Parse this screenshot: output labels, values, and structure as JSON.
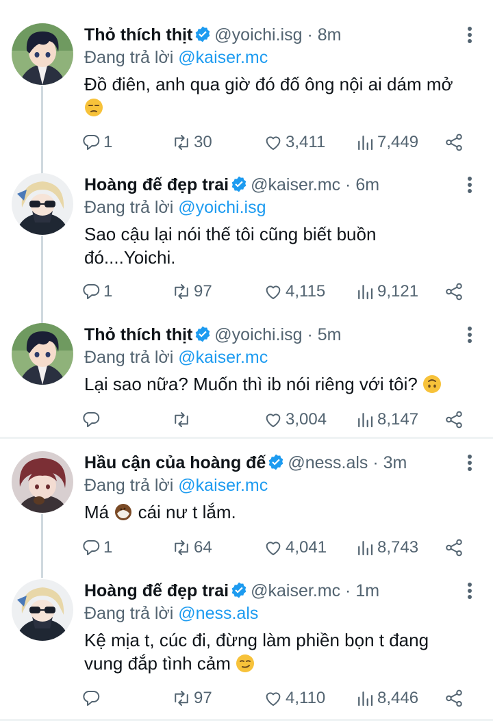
{
  "reply_prefix": "Đang trả lời",
  "tweets": [
    {
      "name": "Thỏ thích thịt",
      "handle": "@yoichi.isg",
      "time": "8m",
      "reply_to": "@kaiser.mc",
      "text_lines": [
        "Đồ điên, anh qua giờ đó đố ông nội ai dám mở"
      ],
      "trailing_emoji": "unamused-face",
      "replies": "1",
      "retweets": "30",
      "likes": "3,411",
      "views": "7,449",
      "avatar": "yoichi"
    },
    {
      "name": "Hoàng đế đẹp trai",
      "handle": "@kaiser.mc",
      "time": "6m",
      "reply_to": "@yoichi.isg",
      "text_lines": [
        "Sao cậu lại nói thế tôi cũng biết buồn",
        "đó....Yoichi."
      ],
      "replies": "1",
      "retweets": "97",
      "likes": "4,115",
      "views": "9,121",
      "avatar": "kaiser"
    },
    {
      "name": "Thỏ thích thịt",
      "handle": "@yoichi.isg",
      "time": "5m",
      "reply_to": "@kaiser.mc",
      "text_lines": [
        "Lại sao nữa? Muốn thì ib nói riêng với tôi?"
      ],
      "inline_emoji": "upside-down-face",
      "replies": "",
      "retweets": "",
      "likes": "3,004",
      "views": "8,147",
      "avatar": "yoichi"
    },
    {
      "name": "Hầu cận của hoàng đế",
      "handle": "@ness.als",
      "time": "3m",
      "reply_to": "@kaiser.mc",
      "text_before": "Má",
      "text_after": "cái nư t lắm.",
      "inline_emoji": "coconut",
      "replies": "1",
      "retweets": "64",
      "likes": "4,041",
      "views": "8,743",
      "avatar": "ness"
    },
    {
      "name": "Hoàng đế đẹp trai",
      "handle": "@kaiser.mc",
      "time": "1m",
      "reply_to": "@ness.als",
      "text_lines": [
        "Kệ mịa t, cúc đi, đừng làm phiền bọn t đang",
        "vung đắp tình cảm"
      ],
      "inline_emoji": "smirking-face",
      "replies": "",
      "retweets": "97",
      "likes": "4,110",
      "views": "8,446",
      "avatar": "kaiser"
    }
  ],
  "colors": {
    "link": "#1d9bf0",
    "secondary": "#536471",
    "verified": "#1d9bf0",
    "thread_line": "#cfd9de"
  }
}
